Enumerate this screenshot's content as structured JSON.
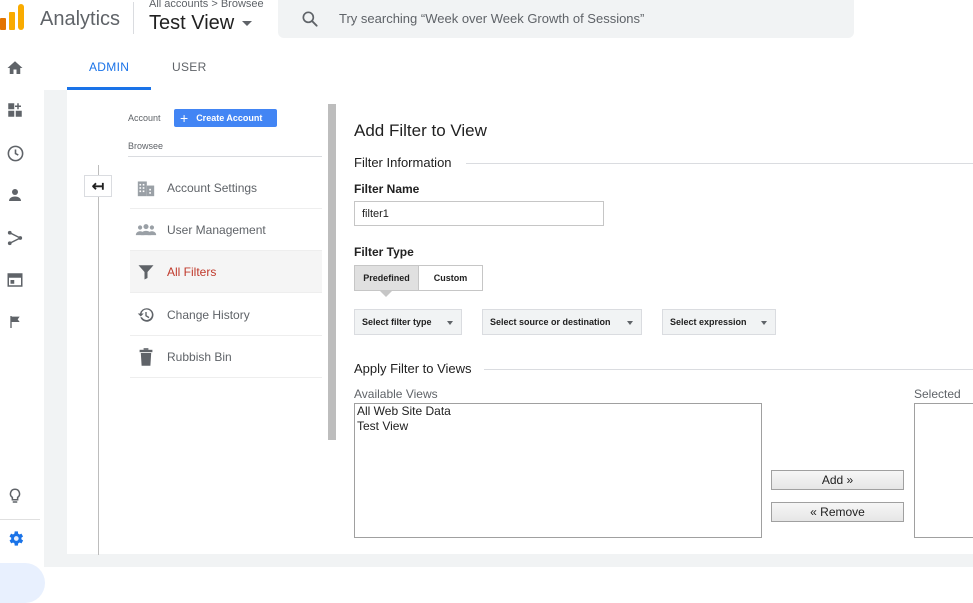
{
  "header": {
    "app_name": "Analytics",
    "breadcrumb": "All accounts > Browsee",
    "view_name": "Test View",
    "search_placeholder": "Try searching “Week over Week Growth of Sessions”"
  },
  "colors": {
    "accent_blue": "#1a73e8",
    "logo_orange": "#f9ab00",
    "logo_dark_orange": "#e37400",
    "active_filter_red": "#c0392b"
  },
  "rail": {
    "items": [
      {
        "name": "home-icon"
      },
      {
        "name": "customization-icon"
      },
      {
        "name": "realtime-icon"
      },
      {
        "name": "audience-icon"
      },
      {
        "name": "acquisition-icon"
      },
      {
        "name": "behavior-icon"
      },
      {
        "name": "conversions-icon"
      },
      {
        "name": "discover-icon"
      },
      {
        "name": "admin-gear-icon"
      }
    ]
  },
  "tabs": [
    {
      "label": "ADMIN",
      "active": true
    },
    {
      "label": "USER",
      "active": false
    }
  ],
  "account": {
    "label": "Account",
    "create_button": "Create Account",
    "account_name": "Browsee"
  },
  "menu": [
    {
      "label": "Account Settings",
      "icon": "building-icon"
    },
    {
      "label": "User Management",
      "icon": "people-icon"
    },
    {
      "label": "All Filters",
      "icon": "filter-icon",
      "active": true
    },
    {
      "label": "Change History",
      "icon": "history-icon"
    },
    {
      "label": "Rubbish Bin",
      "icon": "trash-icon"
    }
  ],
  "form": {
    "title": "Add Filter to View",
    "filter_info_title": "Filter Information",
    "filter_name_label": "Filter Name",
    "filter_name_value": "filter1",
    "filter_type_label": "Filter Type",
    "type_predefined": "Predefined",
    "type_custom": "Custom",
    "dropdown_filter_type": "Select filter type",
    "dropdown_source": "Select source or destination",
    "dropdown_expression": "Select expression",
    "apply_title": "Apply Filter to Views",
    "available_label": "Available Views",
    "selected_label": "Selected vie",
    "available_views": [
      "All Web Site Data",
      "Test View"
    ],
    "add_button": "Add »",
    "remove_button": "« Remove"
  }
}
